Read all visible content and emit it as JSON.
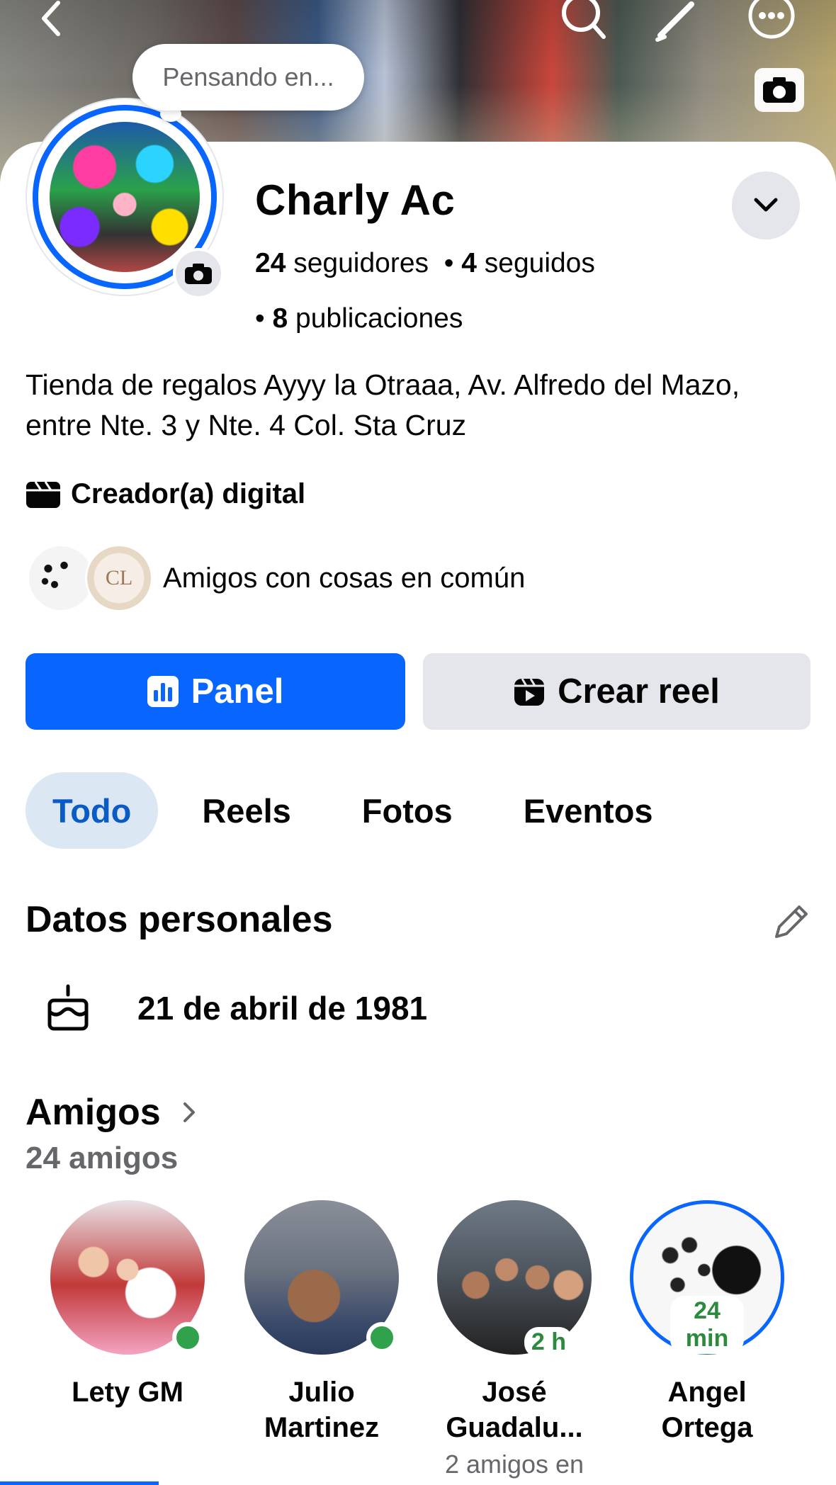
{
  "header": {
    "back_icon": "chevron-left-icon",
    "actions": [
      "search-icon",
      "pencil-icon",
      "more-icon"
    ],
    "cover_camera_icon": "camera-icon"
  },
  "thought_bubble": {
    "placeholder": "Pensando en..."
  },
  "profile": {
    "name": "Charly Ac",
    "followers_count": "24",
    "followers_label": "seguidores",
    "following_count": "4",
    "following_label": "seguidos",
    "posts_count": "8",
    "posts_label": "publicaciones",
    "bio": "Tienda de regalos Ayyy la Otraaa, Av.  Alfredo del Mazo, entre Nte. 3 y Nte. 4 Col. Sta Cruz",
    "category": "Creador(a) digital",
    "mutual_text": "Amigos con cosas en común",
    "mutual_avatar_2_text": "CL"
  },
  "actions": {
    "primary_label": "Panel",
    "secondary_label": "Crear reel"
  },
  "tabs": [
    {
      "label": "Todo",
      "active": true
    },
    {
      "label": "Reels",
      "active": false
    },
    {
      "label": "Fotos",
      "active": false
    },
    {
      "label": "Eventos",
      "active": false
    }
  ],
  "personal": {
    "title": "Datos personales",
    "birthday": "21 de abril de 1981"
  },
  "friends": {
    "title": "Amigos",
    "count": "24 amigos",
    "items": [
      {
        "name": "Lety GM",
        "status": "online",
        "badge": "",
        "sub": ""
      },
      {
        "name": "Julio Martinez",
        "status": "online",
        "badge": "",
        "sub": ""
      },
      {
        "name": "José Guadalu...",
        "status": "recent",
        "badge": "2 h",
        "sub": "2 amigos en"
      },
      {
        "name": "Angel Ortega",
        "status": "recent",
        "badge": "24 min",
        "sub": ""
      }
    ]
  },
  "colors": {
    "accent": "#0866ff",
    "online": "#31a24c",
    "secondary_button": "#e4e6eb",
    "active_tab_bg": "#dbe7f2"
  }
}
